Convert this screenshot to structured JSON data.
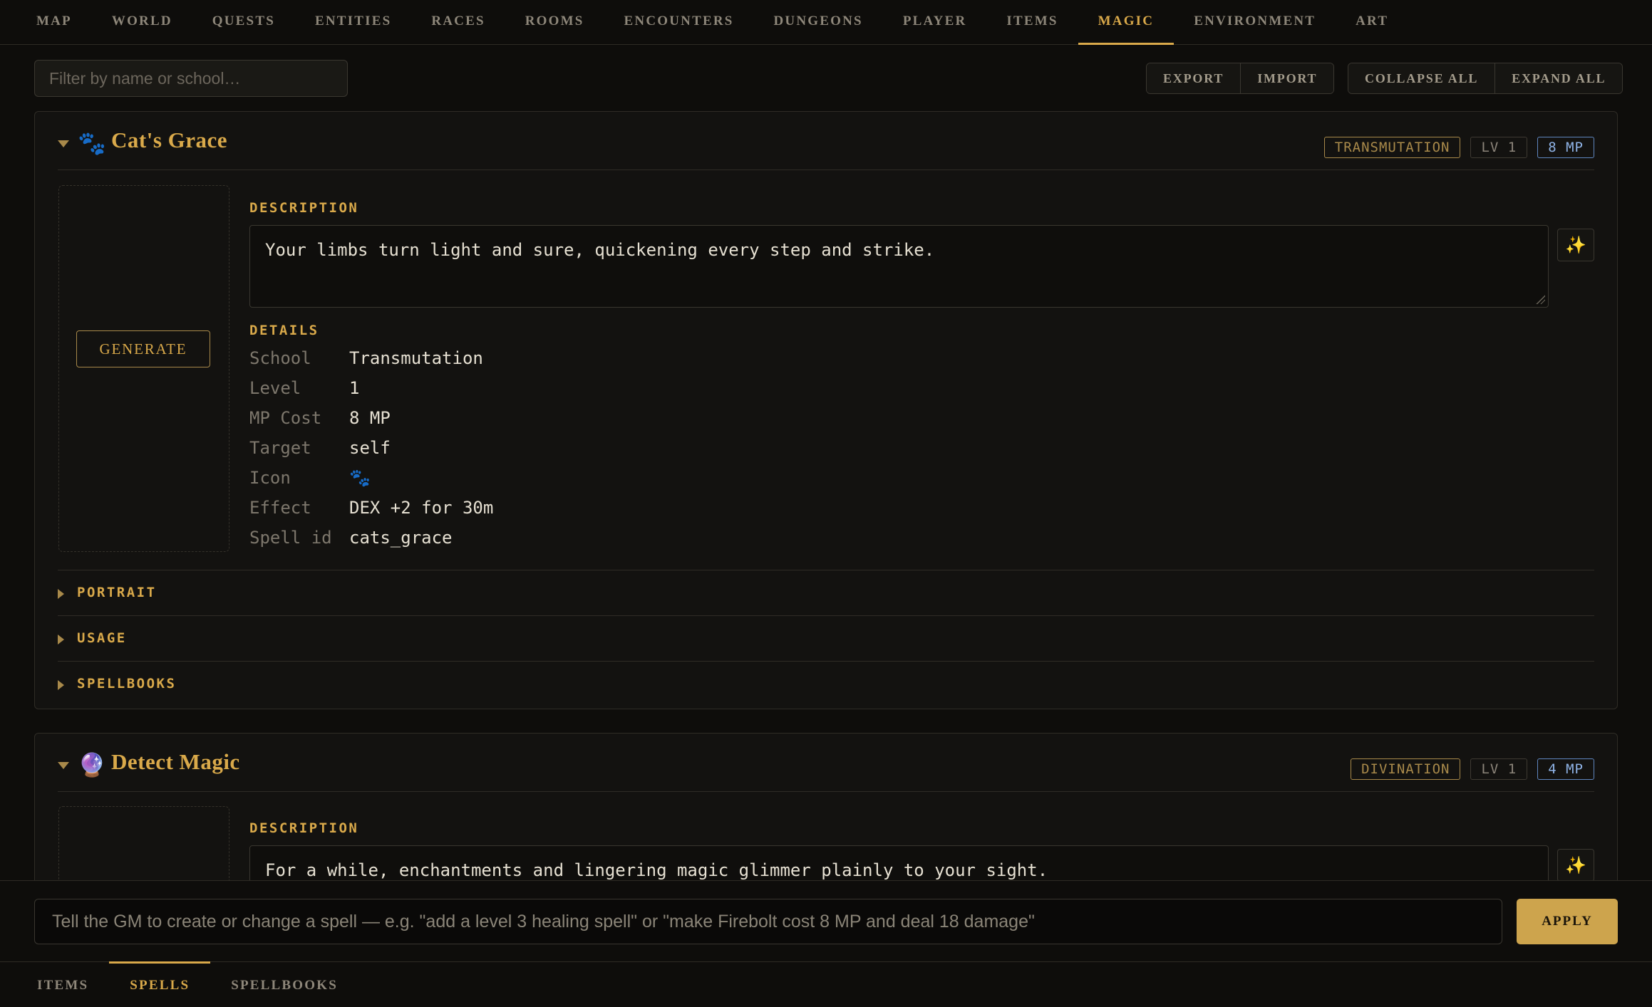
{
  "top_nav": {
    "tabs": [
      "MAP",
      "WORLD",
      "QUESTS",
      "ENTITIES",
      "RACES",
      "ROOMS",
      "ENCOUNTERS",
      "DUNGEONS",
      "PLAYER",
      "ITEMS",
      "MAGIC",
      "ENVIRONMENT",
      "ART"
    ],
    "active": "MAGIC"
  },
  "toolbar": {
    "filter_placeholder": "Filter by name or school…",
    "export_label": "EXPORT",
    "import_label": "IMPORT",
    "collapse_all_label": "COLLAPSE ALL",
    "expand_all_label": "EXPAND ALL"
  },
  "spells": [
    {
      "icon": "🐾",
      "title": "Cat's Grace",
      "badges": {
        "school": "TRANSMUTATION",
        "level": "LV 1",
        "mp": "8 MP"
      },
      "generate_label": "GENERATE",
      "description_label": "DESCRIPTION",
      "description": "Your limbs turn light and sure, quickening every step and strike.",
      "details_label": "DETAILS",
      "details": [
        {
          "key": "School",
          "value": "Transmutation"
        },
        {
          "key": "Level",
          "value": "1"
        },
        {
          "key": "MP Cost",
          "value": "8 MP"
        },
        {
          "key": "Target",
          "value": "self"
        },
        {
          "key": "Icon",
          "value": "🐾"
        },
        {
          "key": "Effect",
          "value": "DEX +2 for 30m"
        },
        {
          "key": "Spell id",
          "value": "cats_grace"
        }
      ],
      "sections": [
        "PORTRAIT",
        "USAGE",
        "SPELLBOOKS"
      ]
    },
    {
      "icon": "🔮",
      "title": "Detect Magic",
      "badges": {
        "school": "DIVINATION",
        "level": "LV 1",
        "mp": "4 MP"
      },
      "description_label": "DESCRIPTION",
      "description": "For a while, enchantments and lingering magic glimmer plainly to your sight."
    }
  ],
  "wand_icon": "✨",
  "gm_prompt": {
    "placeholder": "Tell the GM to create or change a spell — e.g. \"add a level 3 healing spell\" or \"make Firebolt cost 8 MP and deal 18 damage\"",
    "apply_label": "APPLY"
  },
  "bottom_nav": {
    "tabs": [
      "ITEMS",
      "SPELLS",
      "SPELLBOOKS"
    ],
    "active": "SPELLS"
  },
  "colors": {
    "accent": "#d9a94a",
    "mp_badge": "#8fb3e6",
    "background": "#0e0d0b"
  }
}
